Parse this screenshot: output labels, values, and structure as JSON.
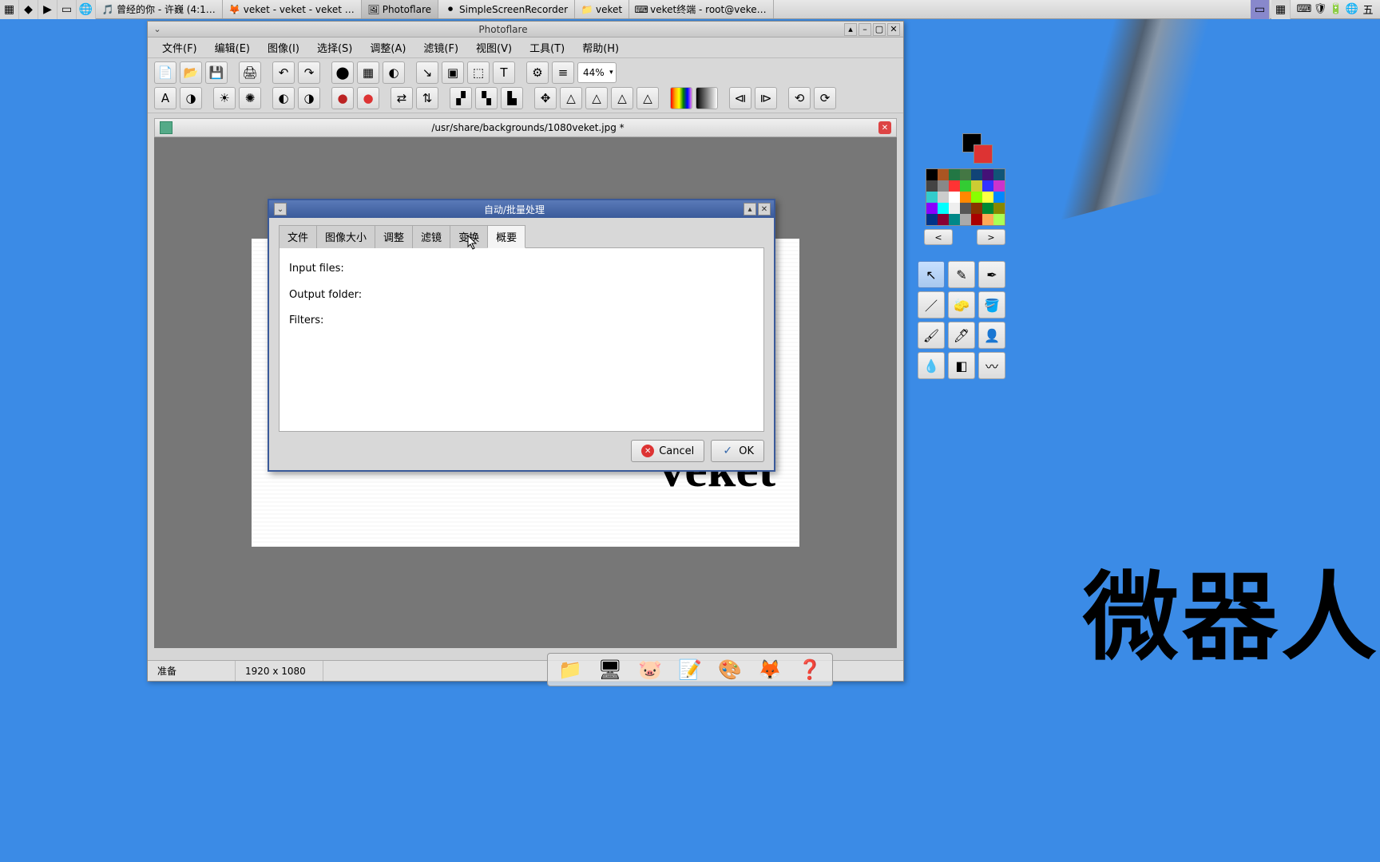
{
  "taskbar": {
    "items": [
      {
        "icon": "🎵",
        "label": "曾经的你 - 许巍 (4:1…"
      },
      {
        "icon": "🦊",
        "label": "veket - veket - veket …"
      },
      {
        "icon": "🖼",
        "label": "Photoflare"
      },
      {
        "icon": "⏺",
        "label": "SimpleScreenRecorder"
      },
      {
        "icon": "📁",
        "label": "veket"
      },
      {
        "icon": "⌨",
        "label": "veket终端 - root@veke…"
      }
    ],
    "active_index": 2,
    "tray": [
      "⌨",
      "🛡",
      "🔋",
      "🌐",
      "五"
    ]
  },
  "window": {
    "title": "Photoflare",
    "menus": [
      "文件(F)",
      "编辑(E)",
      "图像(I)",
      "选择(S)",
      "调整(A)",
      "滤镜(F)",
      "视图(V)",
      "工具(T)",
      "帮助(H)"
    ],
    "zoom": "44%",
    "doc_title": "/usr/share/backgrounds/1080veket.jpg *",
    "status_left": "准备",
    "status_dim": "1920 x 1080",
    "canvas_logo": "veket",
    "palette_prev": "<",
    "palette_next": ">",
    "swatch_colors": [
      "#000",
      "#a52",
      "#274",
      "#474",
      "#147",
      "#417",
      "#157",
      "#444",
      "#888",
      "#f33",
      "#3c3",
      "#cc3",
      "#33f",
      "#c3c",
      "#3cc",
      "#ccc",
      "#fff",
      "#f80",
      "#8f0",
      "#ff4",
      "#08f",
      "#80f",
      "#0ff",
      "#eee",
      "#555",
      "#830",
      "#083",
      "#880",
      "#038",
      "#803",
      "#088",
      "#aaa",
      "#a00",
      "#fa5",
      "#af5",
      "#ffa",
      "#5af",
      "#a5f",
      "#5fa",
      "#fff",
      "#600",
      "#f66"
    ],
    "tools": [
      "↖",
      "✎",
      "✒",
      "／",
      "🧽",
      "🪣",
      "🖌",
      "🖊",
      "👤",
      "💧",
      "◧",
      "〰"
    ]
  },
  "dialog": {
    "title": "自动/批量处理",
    "tabs": [
      "文件",
      "图像大小",
      "调整",
      "滤镜",
      "变换",
      "概要"
    ],
    "active_tab": 5,
    "content": {
      "input_label": "Input files:",
      "output_label": "Output folder:",
      "filters_label": "Filters:"
    },
    "cancel": "Cancel",
    "ok": "OK"
  },
  "desktop": {
    "bg_text": "微器人"
  },
  "dock": {
    "items": [
      "📁",
      "🖥",
      "🐷",
      "📝",
      "🎨",
      "🦊",
      "❓"
    ]
  }
}
